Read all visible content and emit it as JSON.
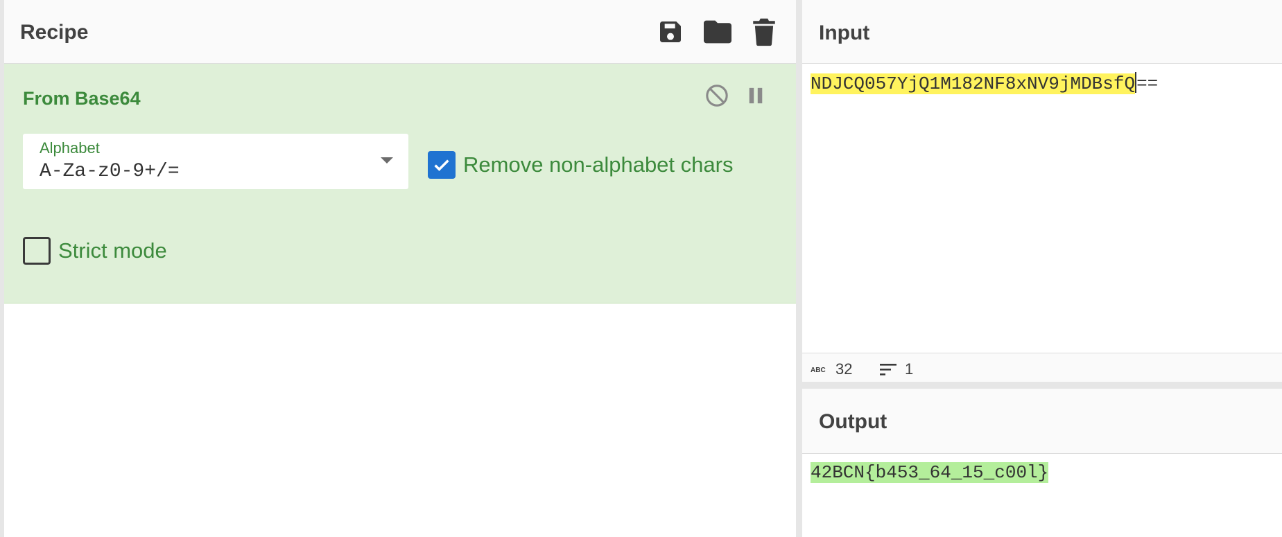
{
  "recipe": {
    "title": "Recipe",
    "header_icons": [
      "save-icon",
      "folder-icon",
      "trash-icon"
    ],
    "operation": {
      "title": "From Base64",
      "icons": [
        "disable-icon",
        "pause-icon"
      ],
      "alphabet": {
        "label": "Alphabet",
        "value": "A-Za-z0-9+/="
      },
      "remove_non_alphabet": {
        "label": "Remove non-alphabet chars",
        "checked": true
      },
      "strict_mode": {
        "label": "Strict mode",
        "checked": false
      }
    }
  },
  "input": {
    "title": "Input",
    "highlighted_text": "NDJCQ057YjQ1M182NF8xNV9jMDBsfQ",
    "trailing_text": "==",
    "stats": {
      "length": "32",
      "lines": "1"
    }
  },
  "output": {
    "title": "Output",
    "text": "42BCN{b453_64_15_c00l}"
  },
  "colors": {
    "operation_bg": "#dff0d8",
    "operation_text": "#3c8a3c",
    "checkbox_checked": "#1f73d1",
    "input_highlight": "#fff35e",
    "output_highlight": "#b4ee9b"
  }
}
